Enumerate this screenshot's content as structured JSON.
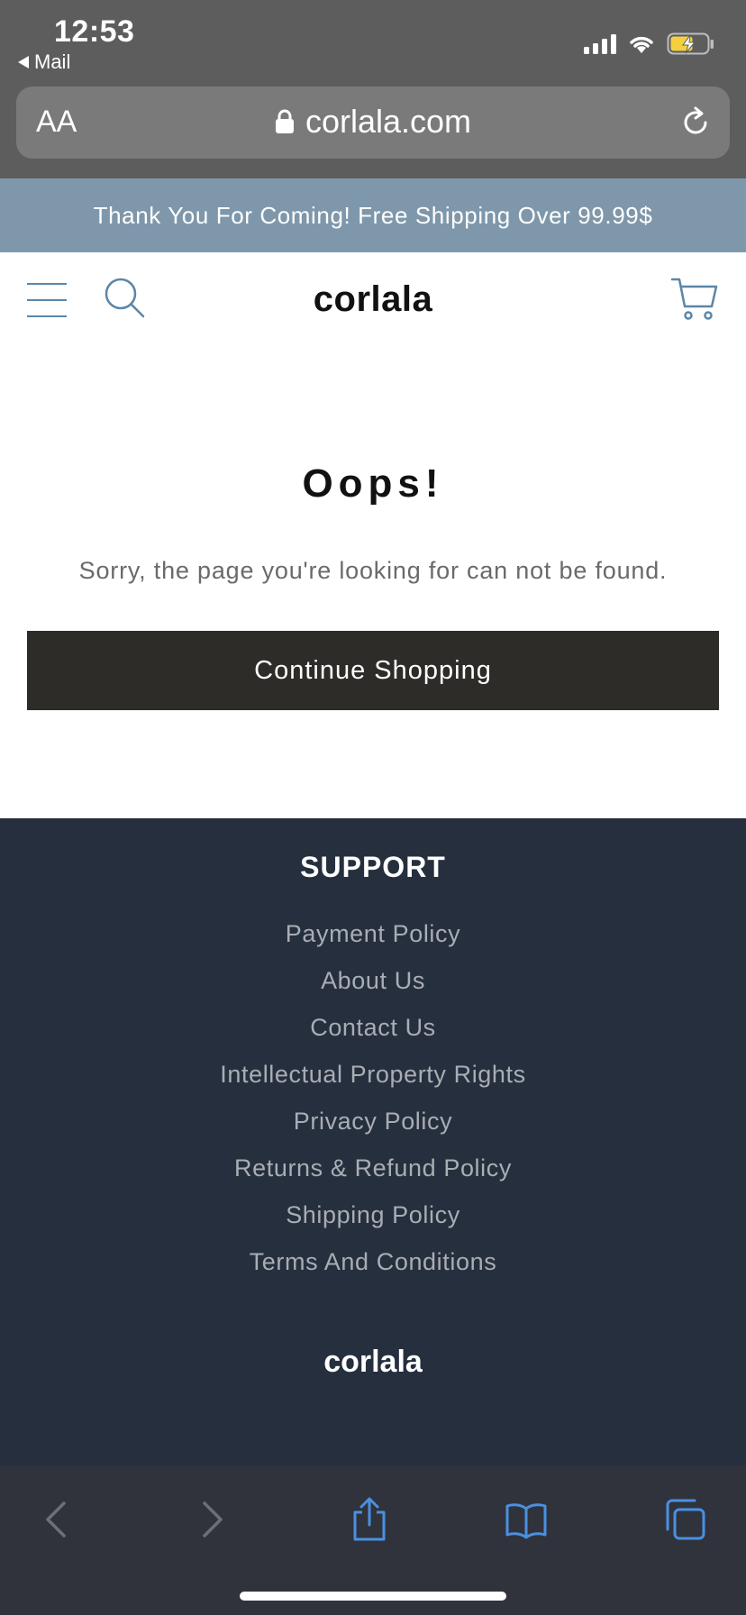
{
  "status_bar": {
    "time": "12:53",
    "back_app": "Mail",
    "icons": [
      "cellular-signal-icon",
      "wifi-icon",
      "battery-charging-icon"
    ]
  },
  "browser": {
    "text_size_label": "AA",
    "url": "corlala.com",
    "icons": [
      "lock-icon",
      "reload-icon"
    ],
    "toolbar": [
      "back-icon",
      "forward-icon",
      "share-icon",
      "bookmarks-icon",
      "tabs-icon"
    ]
  },
  "announcement": {
    "text": "Thank You For Coming! Free Shipping Over 99.99$"
  },
  "header": {
    "logo": "corlala",
    "icons": [
      "menu-icon",
      "search-icon",
      "cart-icon"
    ]
  },
  "main": {
    "title": "Oops!",
    "message": "Sorry, the page you're looking for can not be found.",
    "continue_label": "Continue Shopping"
  },
  "footer": {
    "heading": "SUPPORT",
    "links": [
      "Payment Policy",
      "About Us",
      "Contact Us",
      "Intellectual Property Rights",
      "Privacy Policy",
      "Returns & Refund Policy",
      "Shipping Policy",
      "Terms And Conditions"
    ],
    "logo": "corlala"
  },
  "colors": {
    "announcement_bg": "#7e97ab",
    "accent_icon": "#5b86a8",
    "button_bg": "#2e2c29",
    "footer_bg": "#262f3e",
    "toolbar_icon": "#4a90e2",
    "battery_fill": "#f4d03f"
  }
}
